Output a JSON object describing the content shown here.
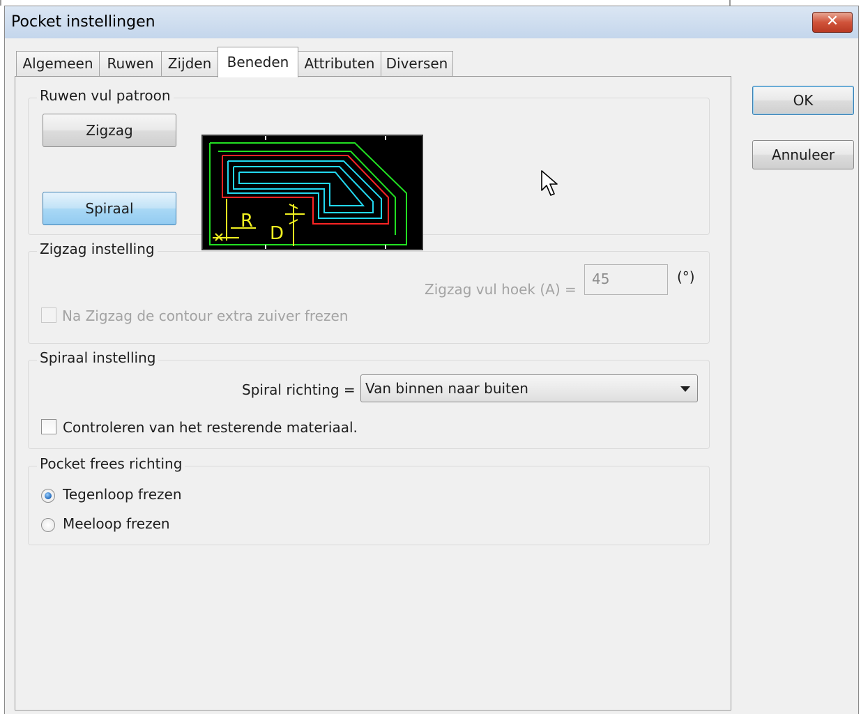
{
  "window": {
    "title": "Pocket instellingen",
    "close_label": "✕"
  },
  "tabs": [
    {
      "label": "Algemeen"
    },
    {
      "label": "Ruwen"
    },
    {
      "label": "Zijden"
    },
    {
      "label": "Beneden"
    },
    {
      "label": "Attributen"
    },
    {
      "label": "Diversen"
    }
  ],
  "active_tab": "Beneden",
  "buttons": {
    "ok": "OK",
    "cancel": "Annuleer"
  },
  "fill_pattern": {
    "title": "Ruwen vul patroon",
    "zigzag_label": "Zigzag",
    "spiral_label": "Spiraal",
    "selected": "Spiraal",
    "diagram": {
      "label_r": "R",
      "label_d": "D"
    }
  },
  "zigzag": {
    "title": "Zigzag instelling",
    "angle_label": "Zigzag vul hoek  (A) =",
    "angle_value": "45",
    "unit": "(°)",
    "checkbox_label": "Na Zigzag de contour extra zuiver frezen"
  },
  "spiral": {
    "title": "Spiraal instelling",
    "direction_label": "Spiral richting  =",
    "direction_value": "Van binnen naar buiten",
    "checkbox_label": "Controleren van het resterende materiaal."
  },
  "direction": {
    "title": "Pocket frees richting",
    "options": [
      {
        "label": "Tegenloop frezen",
        "selected": true
      },
      {
        "label": "Meeloop frezen",
        "selected": false
      }
    ]
  },
  "colors": {
    "titlebar": "#c4d6ec",
    "close": "#c94a33",
    "selected_button": "#a9d8f5"
  }
}
